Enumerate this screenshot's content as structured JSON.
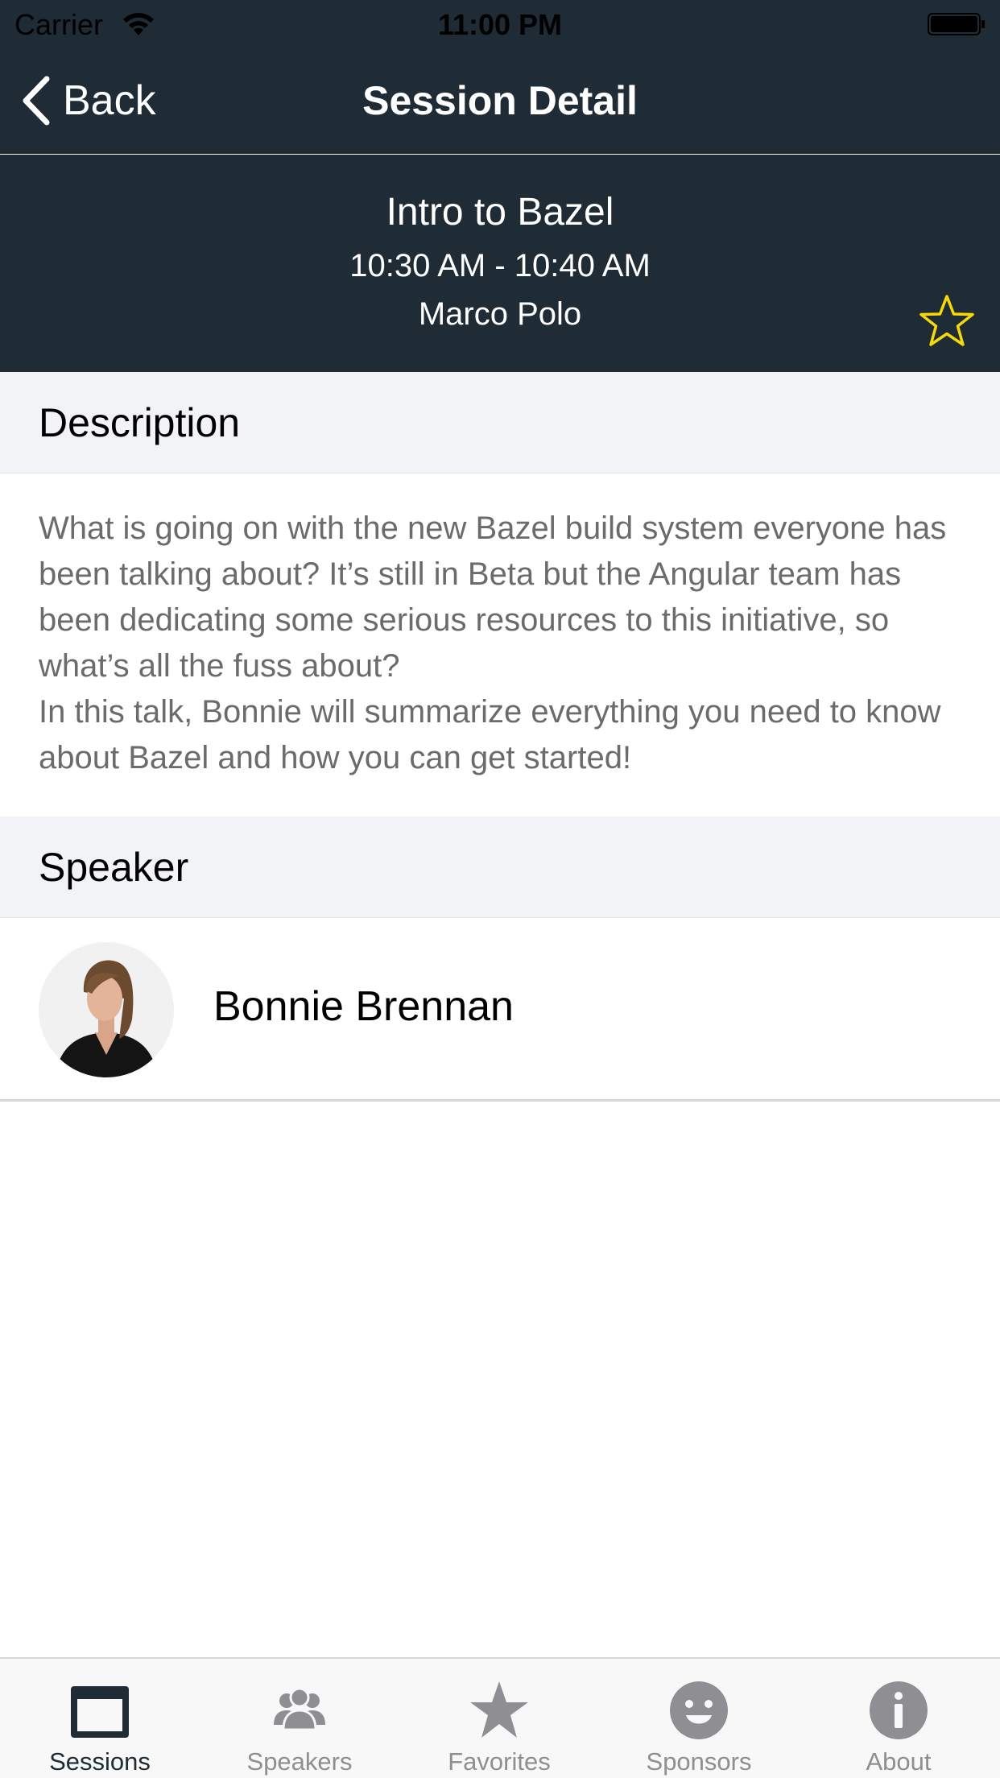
{
  "status_bar": {
    "carrier": "Carrier",
    "time": "11:00 PM"
  },
  "nav": {
    "back_label": "Back",
    "title": "Session Detail"
  },
  "session": {
    "title": "Intro to Bazel",
    "time": "10:30 AM - 10:40 AM",
    "room": "Marco Polo",
    "favorite_icon": "star-outline-icon",
    "favorite_color": "#f5d90a"
  },
  "description_section": {
    "header": "Description",
    "paragraphs": [
      "What is going on with the new Bazel build system everyone has been talking about? It’s still in Beta but the Angular team has been dedicating some serious resources to this initiative, so what’s all the fuss about?",
      "In this talk, Bonnie will summarize everything you need to know about Bazel and how you can get started!"
    ]
  },
  "speaker_section": {
    "header": "Speaker",
    "speakers": [
      {
        "name": "Bonnie Brennan"
      }
    ]
  },
  "tabs": [
    {
      "label": "Sessions",
      "icon": "calendar-icon",
      "active": true
    },
    {
      "label": "Speakers",
      "icon": "people-icon",
      "active": false
    },
    {
      "label": "Favorites",
      "icon": "star-icon",
      "active": false
    },
    {
      "label": "Sponsors",
      "icon": "smiley-icon",
      "active": false
    },
    {
      "label": "About",
      "icon": "info-icon",
      "active": false
    }
  ],
  "colors": {
    "header_bg": "#1f2b35",
    "section_bg": "#f2f3f6",
    "active_tab": "#1f2b35",
    "inactive_tab": "#8e8e93"
  }
}
